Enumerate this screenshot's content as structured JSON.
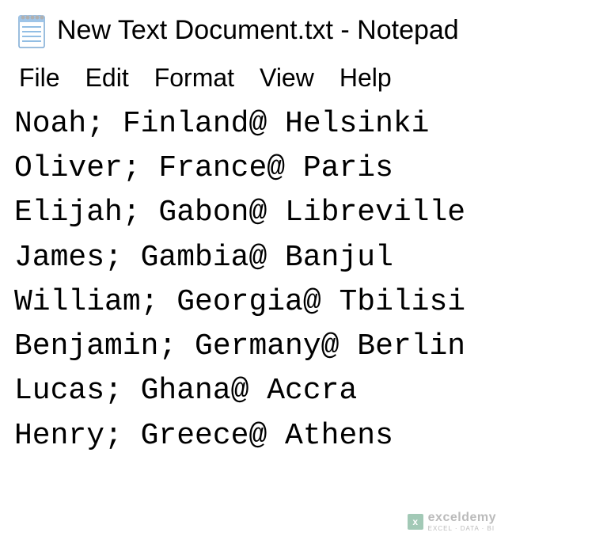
{
  "window": {
    "title": "New Text Document.txt - Notepad"
  },
  "menu": {
    "file": "File",
    "edit": "Edit",
    "format": "Format",
    "view": "View",
    "help": "Help"
  },
  "content": {
    "lines": [
      "Noah; Finland@ Helsinki",
      "Oliver; France@ Paris",
      "Elijah; Gabon@ Libreville",
      "James; Gambia@ Banjul",
      "William; Georgia@ Tbilisi",
      "Benjamin; Germany@ Berlin",
      "Lucas; Ghana@ Accra",
      "Henry; Greece@ Athens"
    ]
  },
  "watermark": {
    "main": "exceldemy",
    "sub": "EXCEL · DATA · BI"
  }
}
